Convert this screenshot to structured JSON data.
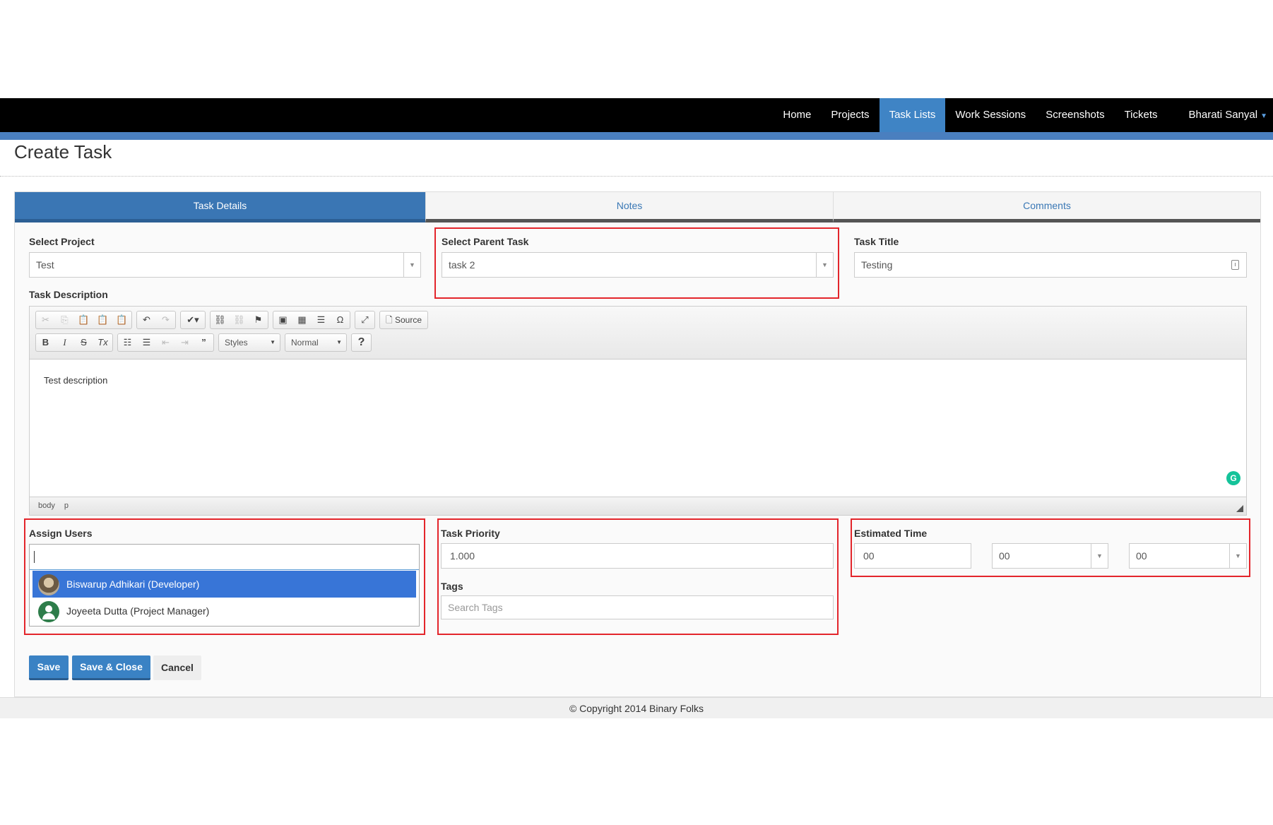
{
  "nav": {
    "items": [
      "Home",
      "Projects",
      "Task Lists",
      "Work Sessions",
      "Screenshots",
      "Tickets"
    ],
    "active": "Task Lists",
    "user": "Bharati Sanyal"
  },
  "page": {
    "title": "Create Task"
  },
  "tabs": [
    "Task Details",
    "Notes",
    "Comments"
  ],
  "form": {
    "project": {
      "label": "Select Project",
      "value": "Test"
    },
    "parent_task": {
      "label": "Select Parent Task",
      "value": "task 2"
    },
    "task_title": {
      "label": "Task Title",
      "value": "Testing"
    },
    "description": {
      "label": "Task Description",
      "content": "Test description",
      "styles_combo": "Styles",
      "format_combo": "Normal",
      "source_label": "Source",
      "status_path": [
        "body",
        "p"
      ]
    },
    "assign_users": {
      "label": "Assign Users",
      "options": [
        {
          "name": "Biswarup Adhikari (Developer)",
          "highlighted": true
        },
        {
          "name": "Joyeeta Dutta (Project Manager)",
          "highlighted": false
        }
      ]
    },
    "priority": {
      "label": "Task Priority",
      "value": "1.000"
    },
    "tags": {
      "label": "Tags",
      "placeholder": "Search Tags"
    },
    "estimated_time": {
      "label": "Estimated Time",
      "days": "00",
      "hours": "00",
      "minutes": "00"
    }
  },
  "buttons": {
    "save": "Save",
    "save_close": "Save & Close",
    "cancel": "Cancel"
  },
  "footer": {
    "text": "© Copyright 2014 Binary Folks"
  },
  "colors": {
    "accent": "#3a76b4",
    "highlight_box": "#e3252b",
    "nav_bg": "#000000"
  }
}
